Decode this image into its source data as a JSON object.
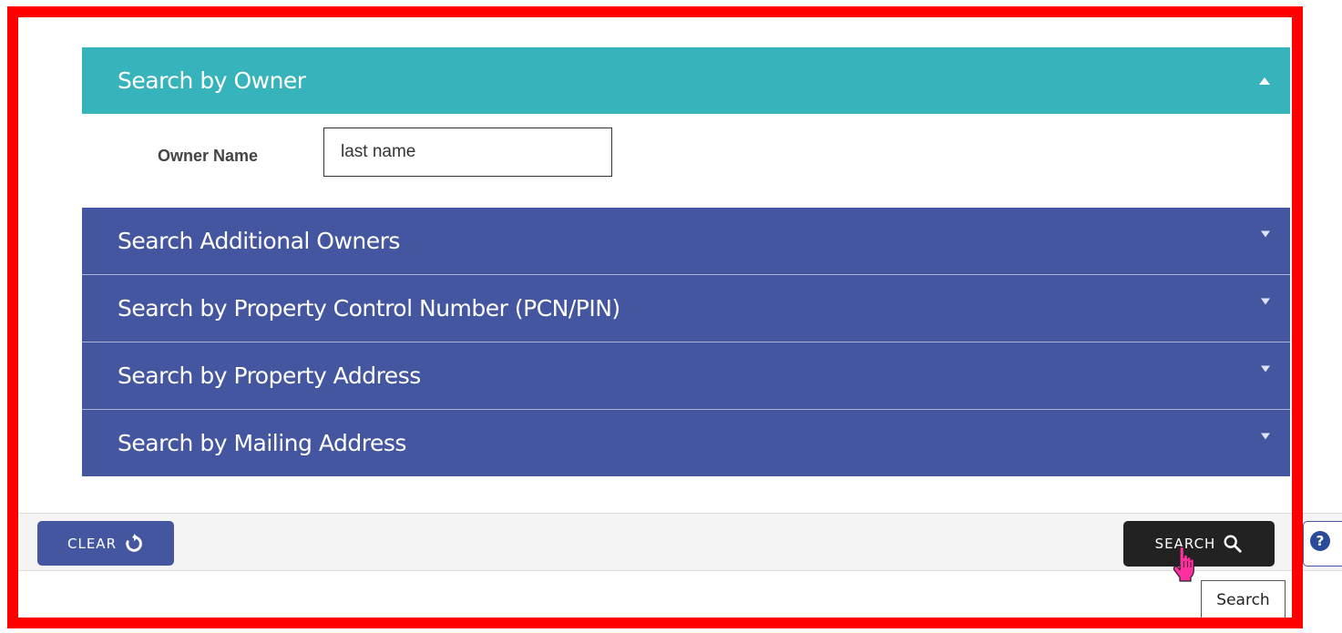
{
  "accordion": {
    "open_section": {
      "title": "Search by Owner",
      "field_label": "Owner Name",
      "field_placeholder": "last name",
      "field_value": ""
    },
    "closed_sections": [
      {
        "title": "Search Additional Owners"
      },
      {
        "title": "Search by Property Control Number (PCN/PIN)"
      },
      {
        "title": "Search by Property Address"
      },
      {
        "title": "Search by Mailing Address"
      }
    ]
  },
  "footer": {
    "clear_label": "CLEAR",
    "search_label": "SEARCH",
    "help_glyph": "?"
  },
  "tooltip": {
    "text": "Search"
  },
  "icons": {
    "clear": "refresh-icon",
    "search": "magnifier-icon",
    "help": "question-icon",
    "cursor": "hand-pointer-icon"
  },
  "colors": {
    "open_header": "#37b3bc",
    "closed_header": "#4456a0",
    "search_button": "#222222",
    "clear_button": "#4456a0",
    "annotation_frame": "#ff0000"
  }
}
